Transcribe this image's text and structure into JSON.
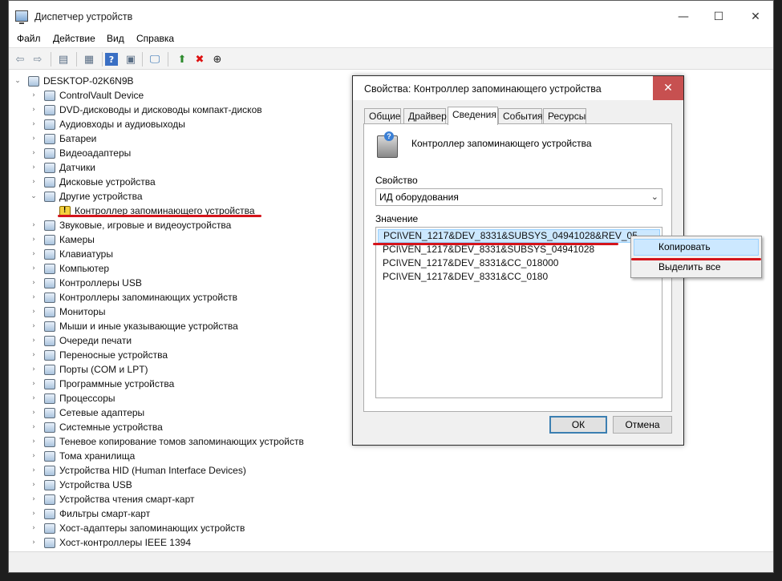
{
  "window": {
    "title": "Диспетчер устройств",
    "controls": {
      "minimize": "—",
      "maximize": "☐",
      "close": "✕"
    }
  },
  "menu": [
    "Файл",
    "Действие",
    "Вид",
    "Справка"
  ],
  "toolbar": {
    "icons": [
      "back-arrow-icon",
      "forward-arrow-icon",
      "show-hide-tree-icon",
      "properties-icon",
      "help-icon",
      "action-pane-icon",
      "monitor-scan-icon",
      "update-driver-icon",
      "uninstall-icon",
      "download-icon"
    ]
  },
  "tree": {
    "root": "DESKTOP-02K6N9B",
    "items": [
      {
        "label": "ControlVault Device",
        "expanded": false
      },
      {
        "label": "DVD-дисководы и дисководы компакт-дисков",
        "expanded": false
      },
      {
        "label": "Аудиовходы и аудиовыходы",
        "expanded": false
      },
      {
        "label": "Батареи",
        "expanded": false
      },
      {
        "label": "Видеоадаптеры",
        "expanded": false
      },
      {
        "label": "Датчики",
        "expanded": false
      },
      {
        "label": "Дисковые устройства",
        "expanded": false
      },
      {
        "label": "Другие устройства",
        "expanded": true
      },
      {
        "label": "Контроллер запоминающего устройства",
        "child": true,
        "warning": true
      },
      {
        "label": "Звуковые, игровые и видеоустройства",
        "expanded": false
      },
      {
        "label": "Камеры",
        "expanded": false
      },
      {
        "label": "Клавиатуры",
        "expanded": false
      },
      {
        "label": "Компьютер",
        "expanded": false
      },
      {
        "label": "Контроллеры USB",
        "expanded": false
      },
      {
        "label": "Контроллеры запоминающих устройств",
        "expanded": false
      },
      {
        "label": "Мониторы",
        "expanded": false
      },
      {
        "label": "Мыши и иные указывающие устройства",
        "expanded": false
      },
      {
        "label": "Очереди печати",
        "expanded": false
      },
      {
        "label": "Переносные устройства",
        "expanded": false
      },
      {
        "label": "Порты (COM и LPT)",
        "expanded": false
      },
      {
        "label": "Программные устройства",
        "expanded": false
      },
      {
        "label": "Процессоры",
        "expanded": false
      },
      {
        "label": "Сетевые адаптеры",
        "expanded": false
      },
      {
        "label": "Системные устройства",
        "expanded": false
      },
      {
        "label": "Теневое копирование томов запоминающих устройств",
        "expanded": false
      },
      {
        "label": "Тома хранилища",
        "expanded": false
      },
      {
        "label": "Устройства HID (Human Interface Devices)",
        "expanded": false
      },
      {
        "label": "Устройства USB",
        "expanded": false
      },
      {
        "label": "Устройства чтения смарт-карт",
        "expanded": false
      },
      {
        "label": "Фильтры смарт-карт",
        "expanded": false
      },
      {
        "label": "Хост-адаптеры запоминающих устройств",
        "expanded": false
      },
      {
        "label": "Хост-контроллеры IEEE 1394",
        "expanded": false
      }
    ]
  },
  "dialog": {
    "title": "Свойства: Контроллер запоминающего устройства",
    "close": "✕",
    "tabs": [
      "Общие",
      "Драйвер",
      "Сведения",
      "События",
      "Ресурсы"
    ],
    "active_tab": "Сведения",
    "device_name": "Контроллер запоминающего устройства",
    "property_label": "Свойство",
    "property_value": "ИД оборудования",
    "value_label": "Значение",
    "values": [
      "PCI\\VEN_1217&DEV_8331&SUBSYS_04941028&REV_05",
      "PCI\\VEN_1217&DEV_8331&SUBSYS_04941028",
      "PCI\\VEN_1217&DEV_8331&CC_018000",
      "PCI\\VEN_1217&DEV_8331&CC_0180"
    ],
    "ok": "ОК",
    "cancel": "Отмена"
  },
  "context_menu": {
    "items": [
      "Копировать",
      "Выделить все"
    ]
  },
  "annotation_color": "#d4141b"
}
